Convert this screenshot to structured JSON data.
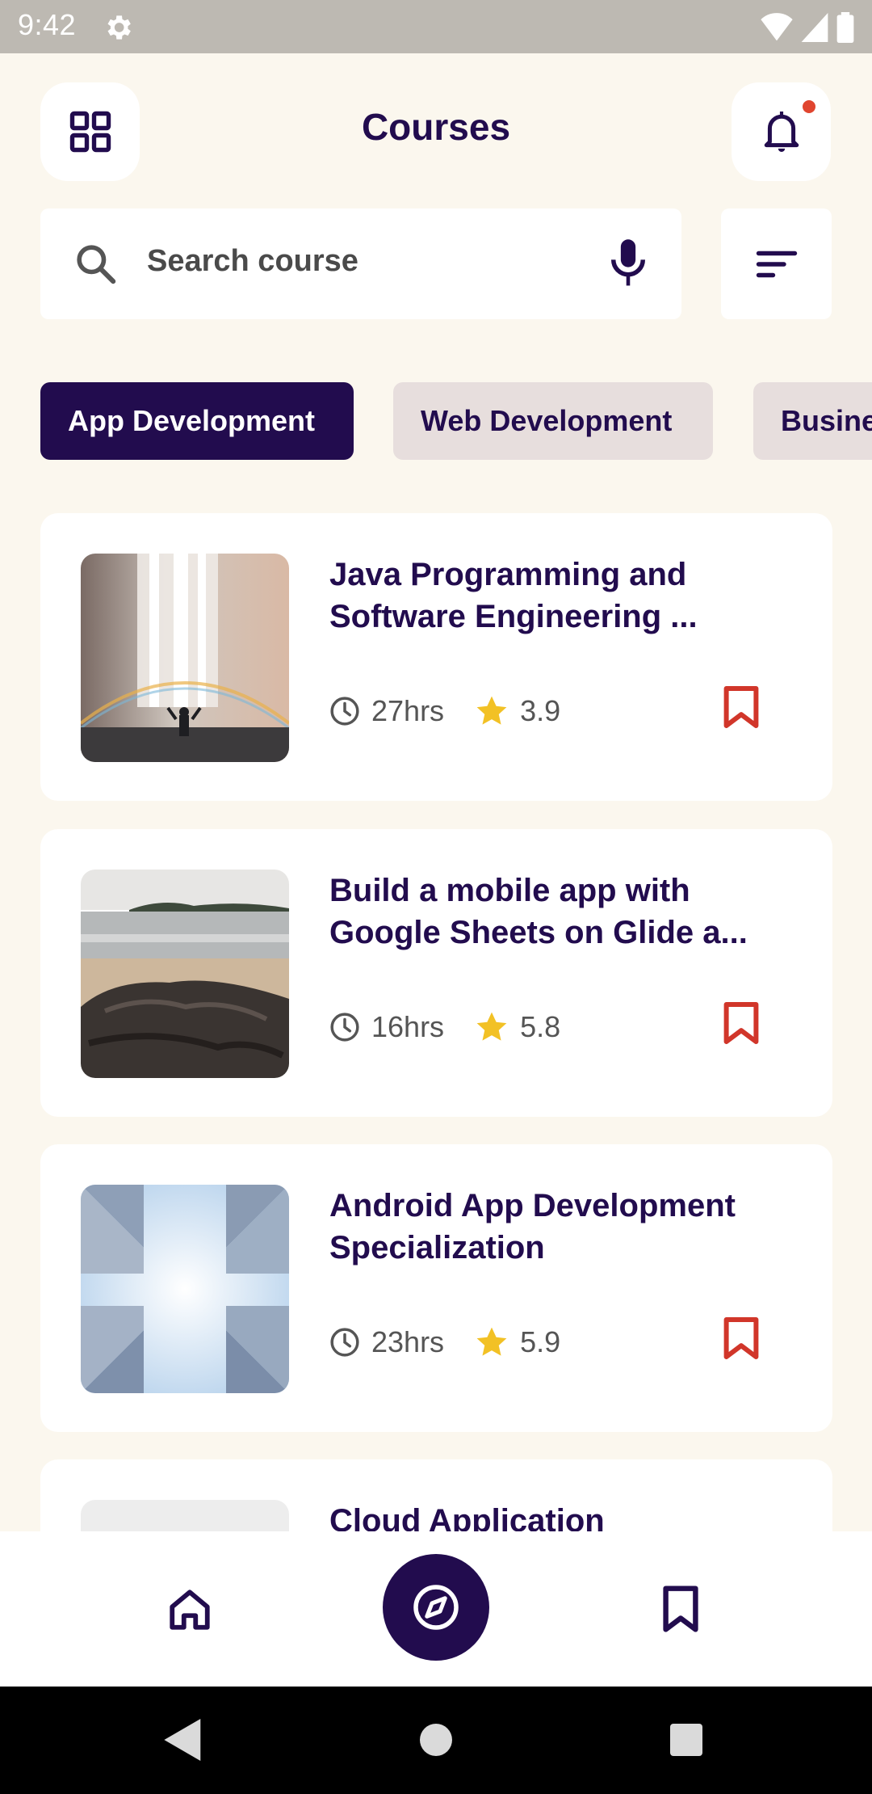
{
  "status_bar": {
    "time": "9:42",
    "icons": [
      "gear-icon",
      "wifi-icon",
      "signal-icon",
      "battery-icon"
    ]
  },
  "header": {
    "title": "Courses",
    "menu_icon": "grid-icon",
    "bell_icon": "bell-icon",
    "has_notification": true
  },
  "search": {
    "placeholder": "Search course",
    "search_icon": "search-icon",
    "mic_icon": "mic-icon",
    "filter_icon": "sort-icon"
  },
  "categories": [
    {
      "label": "App Development",
      "selected": true
    },
    {
      "label": "Web Development",
      "selected": false
    },
    {
      "label": "Busine",
      "selected": false
    }
  ],
  "courses": [
    {
      "title_line1": "Java Programming and",
      "title_line2": "Software Engineering ...",
      "hours": "27hrs",
      "rating": "3.9",
      "image": "waterfall"
    },
    {
      "title_line1": "Build a mobile app with",
      "title_line2": "Google Sheets on Glide a...",
      "hours": "16hrs",
      "rating": "5.8",
      "image": "beach"
    },
    {
      "title_line1": "Android App Development",
      "title_line2": "Specialization",
      "hours": "23hrs",
      "rating": "5.9",
      "image": "buildings"
    },
    {
      "title_line1": "Cloud Application",
      "title_line2": "",
      "hours": "",
      "rating": "",
      "image": "blank"
    }
  ],
  "colors": {
    "primary": "#220C4E",
    "background": "#FBF7EE",
    "chip_inactive": "#E7DEDD",
    "bookmark": "#D1362A",
    "star": "#F2C125",
    "notification": "#E0452F"
  },
  "bottom_nav": {
    "items": [
      "home-icon",
      "compass-icon",
      "bookmark-icon"
    ],
    "active": "compass-icon"
  }
}
